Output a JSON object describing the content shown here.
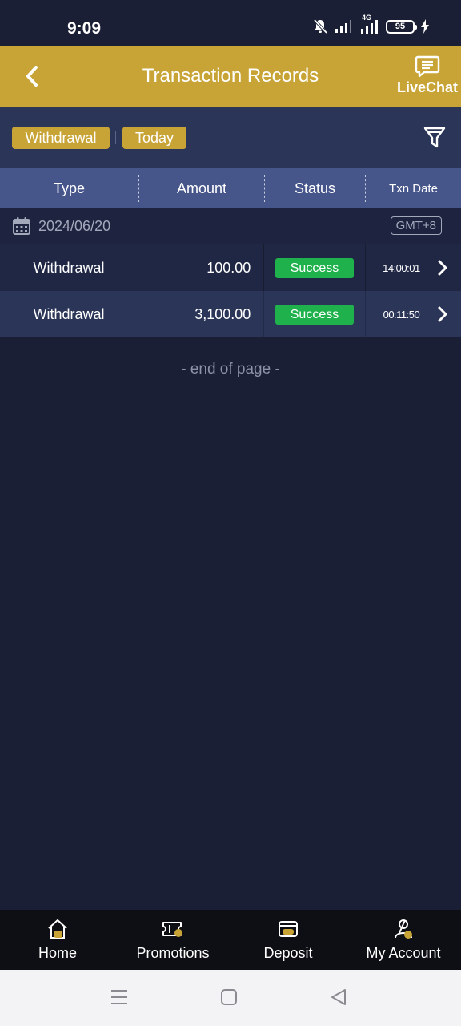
{
  "status_bar": {
    "time": "9:09",
    "network": "4G",
    "battery": "95"
  },
  "header": {
    "title": "Transaction Records",
    "livechat_label": "LiveChat"
  },
  "filters": {
    "type": "Withdrawal",
    "date_range": "Today"
  },
  "table": {
    "columns": [
      "Type",
      "Amount",
      "Status",
      "Txn Date"
    ]
  },
  "date_group": {
    "date": "2024/06/20",
    "timezone": "GMT+8"
  },
  "transactions": [
    {
      "type": "Withdrawal",
      "amount": "100.00",
      "status": "Success",
      "time": "14:00:01"
    },
    {
      "type": "Withdrawal",
      "amount": "3,100.00",
      "status": "Success",
      "time": "00:11:50"
    }
  ],
  "end_text": "- end of page -",
  "bottom_nav": {
    "items": [
      {
        "label": "Home",
        "icon": "home-icon"
      },
      {
        "label": "Promotions",
        "icon": "promotions-ticket-icon"
      },
      {
        "label": "Deposit",
        "icon": "deposit-card-icon"
      },
      {
        "label": "My Account",
        "icon": "account-user-icon"
      }
    ]
  },
  "colors": {
    "accent_gold": "#c8a437",
    "background": "#1a1f35",
    "success": "#1fb14b",
    "table_header": "#46558a"
  }
}
